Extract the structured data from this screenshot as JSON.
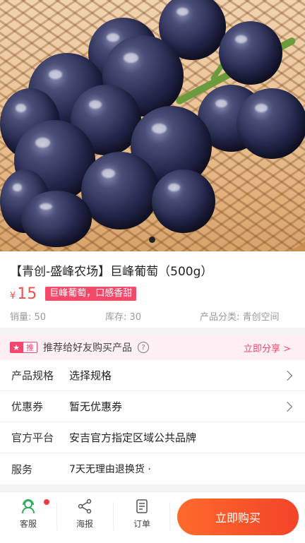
{
  "product": {
    "title": "【青创-盛峰农场】巨峰葡萄（500g）",
    "currency": "¥",
    "price": "15",
    "promo_tag": "巨峰葡萄，口感香甜",
    "sales": "销量: 50",
    "stock": "库存: 30",
    "category": "产品分类: 青创空间",
    "image_pages": 1,
    "current_image": 1
  },
  "share": {
    "badge": "推",
    "label": "推荐给好友购买产品",
    "help": "?",
    "link": "立即分享 >"
  },
  "rows": {
    "spec_label": "产品规格",
    "spec_value": "选择规格",
    "coupon_label": "优惠券",
    "coupon_value": "暂无优惠券",
    "platform_label": "官方平台",
    "platform_value": "安吉官方指定区域公共品牌",
    "service_label": "服务",
    "service_value": "7天无理由退换货 ·"
  },
  "bottom_nav": {
    "service": "客服",
    "poster": "海报",
    "orders": "订单",
    "buy": "立即购买"
  },
  "colors": {
    "price": "#f04e4e",
    "accent": "#f2486f",
    "buy_button": "#f2442a"
  }
}
